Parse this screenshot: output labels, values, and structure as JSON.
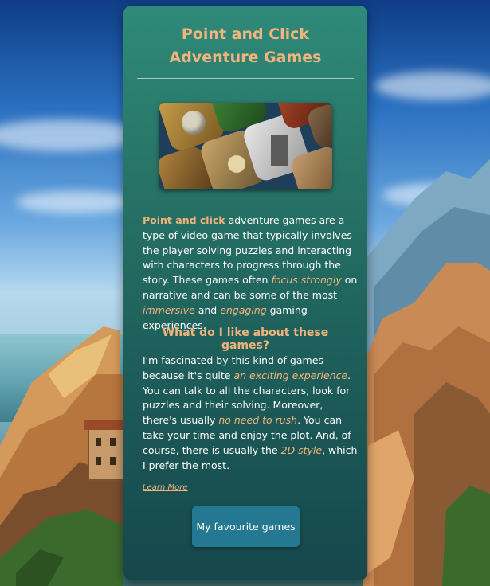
{
  "card": {
    "title": "Point and Click Adventure Games",
    "hero_image": "adventure-game-icons-image",
    "intro": {
      "lead": "Point and click",
      "p1": " adventure games are a type of video game that typically involves the player solving puzzles and interacting with characters to progress through the story. These games often ",
      "focus": "focus strongly",
      "p2": " on narrative and can be some of the most ",
      "immersive": "immersive",
      "p3": " and ",
      "engaging": "engaging",
      "p4": " gaming experiences."
    },
    "subheading": "What do I like about these games?",
    "body": {
      "p1": "I'm fascinated by this kind of games because it's quite ",
      "exciting": "an exciting experience",
      "p2": ". You can talk to all the characters, look for puzzles and their solving. Moreover, there's usually ",
      "rush": "no need to rush",
      "p3": ". You can take your time and enjoy the plot. And, of course, there is usually the ",
      "style": "2D style",
      "p4": ", which I prefer the most."
    },
    "learn_more": "Learn More",
    "button": "My favourite games"
  },
  "colors": {
    "accent": "#f2b47c",
    "card_top": "#2f8a79",
    "card_bottom": "#16474c",
    "button": "#257891"
  }
}
